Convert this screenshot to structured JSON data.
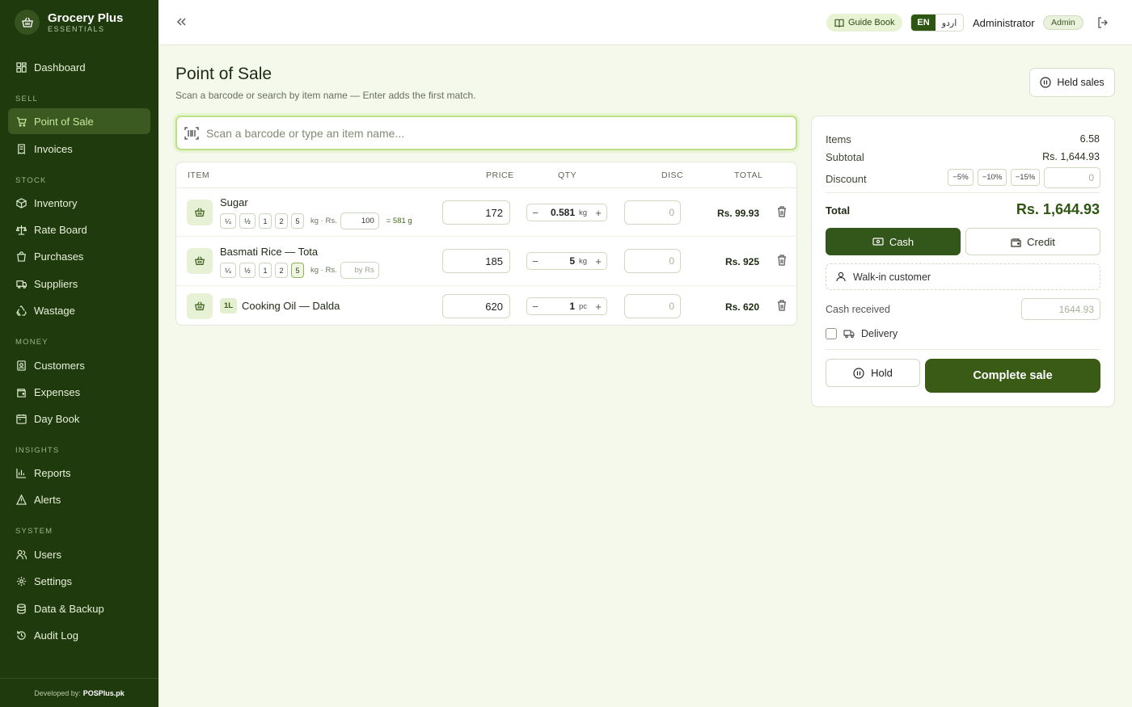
{
  "brand": {
    "name": "Grocery Plus",
    "tagline": "ESSENTIALS"
  },
  "sidebar": {
    "dashboard": "Dashboard",
    "sections": {
      "sell": "SELL",
      "stock": "STOCK",
      "money": "MONEY",
      "insights": "INSIGHTS",
      "system": "SYSTEM"
    },
    "items": {
      "pos": "Point of Sale",
      "invoices": "Invoices",
      "inventory": "Inventory",
      "rate_board": "Rate Board",
      "purchases": "Purchases",
      "suppliers": "Suppliers",
      "wastage": "Wastage",
      "customers": "Customers",
      "expenses": "Expenses",
      "day_book": "Day Book",
      "reports": "Reports",
      "alerts": "Alerts",
      "users": "Users",
      "settings": "Settings",
      "data_backup": "Data & Backup",
      "audit_log": "Audit Log"
    },
    "active": "pos",
    "footer": {
      "prefix": "Developed by:",
      "company": "POSPlus.pk"
    }
  },
  "topbar": {
    "guide_book": "Guide Book",
    "lang_en": "EN",
    "lang_ur": "اردو",
    "user_name": "Administrator",
    "role": "Admin"
  },
  "page": {
    "title": "Point of Sale",
    "subtitle": "Scan a barcode or search by item name — Enter adds the first match.",
    "held_sales": "Held sales"
  },
  "search": {
    "placeholder": "Scan a barcode or type an item name..."
  },
  "cart": {
    "headers": {
      "item": "ITEM",
      "price": "PRICE",
      "qty": "QTY",
      "disc": "DISC",
      "total": "TOTAL"
    },
    "fraction_chips": [
      "¼",
      "½",
      "1",
      "2",
      "5"
    ],
    "rows": [
      {
        "name": "Sugar",
        "price": "172",
        "qty": "0.581",
        "unit": "kg",
        "disc_placeholder": "0",
        "total": "Rs. 99.93",
        "unit_label": "kg · Rs.",
        "rs_value": "100",
        "grams": "= 581 g"
      },
      {
        "name": "Basmati Rice — Tota",
        "price": "185",
        "qty": "5",
        "unit": "kg",
        "disc_placeholder": "0",
        "total": "Rs. 925",
        "unit_label": "kg · Rs.",
        "rs_placeholder": "by Rs",
        "selected_chip": "5"
      },
      {
        "badge": "1L",
        "name": "Cooking Oil — Dalda",
        "price": "620",
        "qty": "1",
        "unit": "pc",
        "disc_placeholder": "0",
        "total": "Rs. 620"
      }
    ]
  },
  "summary": {
    "items_label": "Items",
    "items_value": "6.58",
    "subtotal_label": "Subtotal",
    "subtotal_value": "Rs. 1,644.93",
    "discount_label": "Discount",
    "discount_presets": [
      "−5%",
      "−10%",
      "−15%"
    ],
    "discount_placeholder": "0",
    "total_label": "Total",
    "total_value": "Rs. 1,644.93",
    "cash": "Cash",
    "credit": "Credit",
    "customer": "Walk-in customer",
    "cash_received_label": "Cash received",
    "cash_received_placeholder": "1644.93",
    "delivery": "Delivery",
    "hold": "Hold",
    "complete": "Complete sale"
  },
  "colors": {
    "sidebar": "#1f3a0c",
    "accent": "#33561a",
    "background": "#f4f9ec"
  }
}
